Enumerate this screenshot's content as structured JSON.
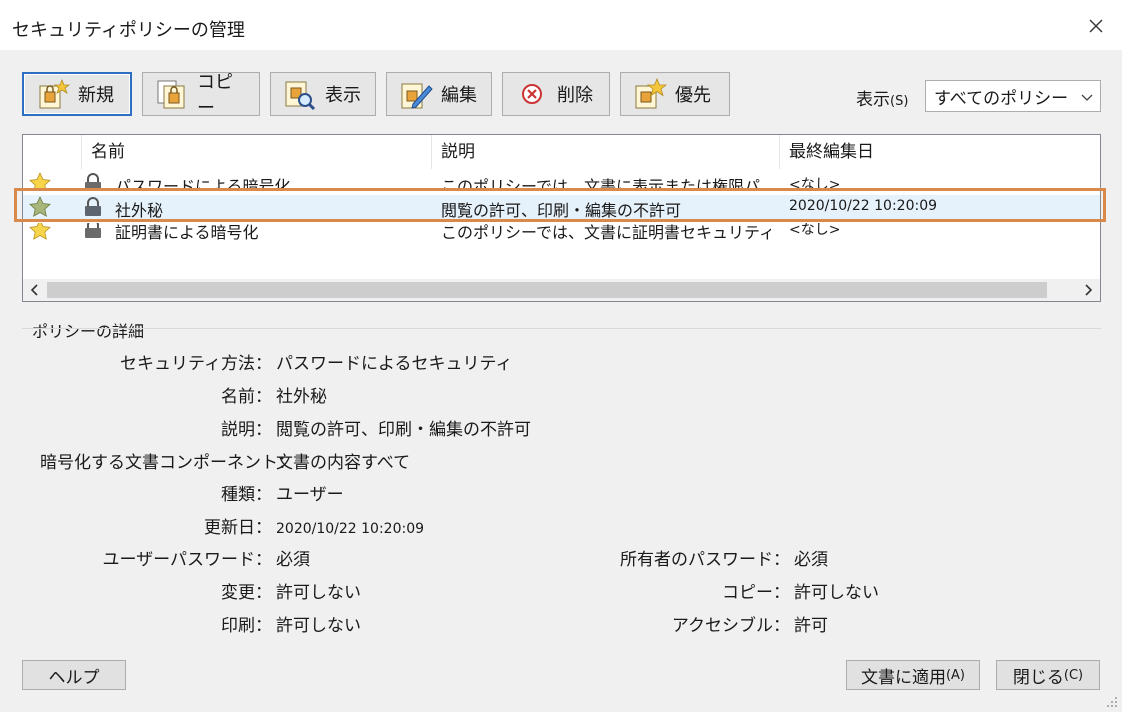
{
  "dialog": {
    "title": "セキュリティポリシーの管理"
  },
  "toolbar": {
    "new_label": "新規",
    "copy_label": "コピー",
    "view_label": "表示",
    "edit_label": "編集",
    "delete_label": "削除",
    "priority_label": "優先"
  },
  "filter": {
    "label": "表示",
    "accel": "(S)",
    "selected": "すべてのポリシー"
  },
  "list": {
    "headers": {
      "name": "名前",
      "description": "説明",
      "modified": "最終編集日"
    },
    "rows": [
      {
        "name": "パスワードによる暗号化",
        "description": "このポリシーでは、文書に表示または権限パ...",
        "modified": "<なし>"
      },
      {
        "name": "社外秘",
        "description": "閲覧の許可、印刷・編集の不許可",
        "modified": "2020/10/22 10:20:09"
      },
      {
        "name": "証明書による暗号化",
        "description": "このポリシーでは、文書に証明書セキュリティ...",
        "modified": "<なし>"
      }
    ]
  },
  "details": {
    "group_title": "ポリシーの詳細",
    "security_method_label": "セキュリティ方法：",
    "security_method": "パスワードによるセキュリティ",
    "name_label": "名前：",
    "name": "社外秘",
    "description_label": "説明：",
    "description": "閲覧の許可、印刷・編集の不許可",
    "components_label": "暗号化する文書コンポーネント：",
    "components": "文書の内容すべて",
    "type_label": "種類：",
    "type": "ユーザー",
    "updated_label": "更新日：",
    "updated": "2020/10/22 10:20:09",
    "user_password_label": "ユーザーパスワード：",
    "user_password": "必須",
    "change_label": "変更：",
    "change": "許可しない",
    "print_label": "印刷：",
    "print": "許可しない",
    "owner_password_label": "所有者のパスワード：",
    "owner_password": "必須",
    "copy_label": "コピー：",
    "copy": "許可しない",
    "accessible_label": "アクセシブル：",
    "accessible": "許可"
  },
  "footer": {
    "help_label": "ヘルプ",
    "apply_label": "文書に適用",
    "apply_accel": "(A)",
    "close_label": "閉じる",
    "close_accel": "(C)"
  },
  "colors": {
    "accent": "#2f6fc2",
    "highlight_outline": "#d98a4a",
    "selection": "#e5f1fb"
  }
}
